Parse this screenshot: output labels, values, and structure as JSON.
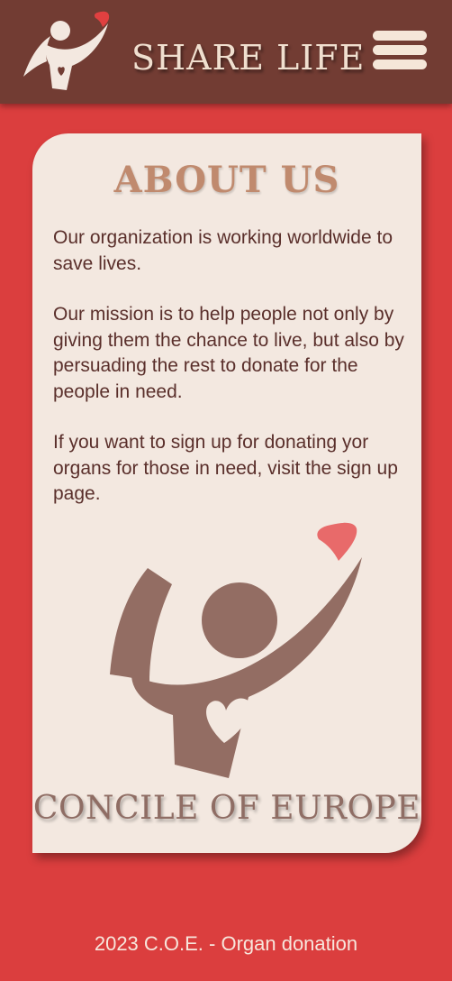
{
  "header": {
    "brand": "SHARE LIFE",
    "menu_icon": "hamburger-menu-icon",
    "logo_icon": "person-heart-logo-icon"
  },
  "about": {
    "title": "ABOUT US",
    "paragraphs": [
      "Our organization is working worldwide to save lives.",
      "Our mission is to help people not only by giving them the chance to live, but also by persuading the rest to donate for the people in need.",
      "If you want to sign up for donating yor organs for those in need, visit the sign up page."
    ],
    "emblem_icon": "person-heart-emblem-icon",
    "organization": "CONCILE OF EUROPE"
  },
  "footer": {
    "text": "2023 C.O.E. - Organ donation"
  },
  "colors": {
    "background": "#db3e3e",
    "header": "#723c33",
    "card": "#f3e8e0",
    "title": "#c08a6e",
    "emblem": "#936d63",
    "heart": "#e86a6a"
  }
}
